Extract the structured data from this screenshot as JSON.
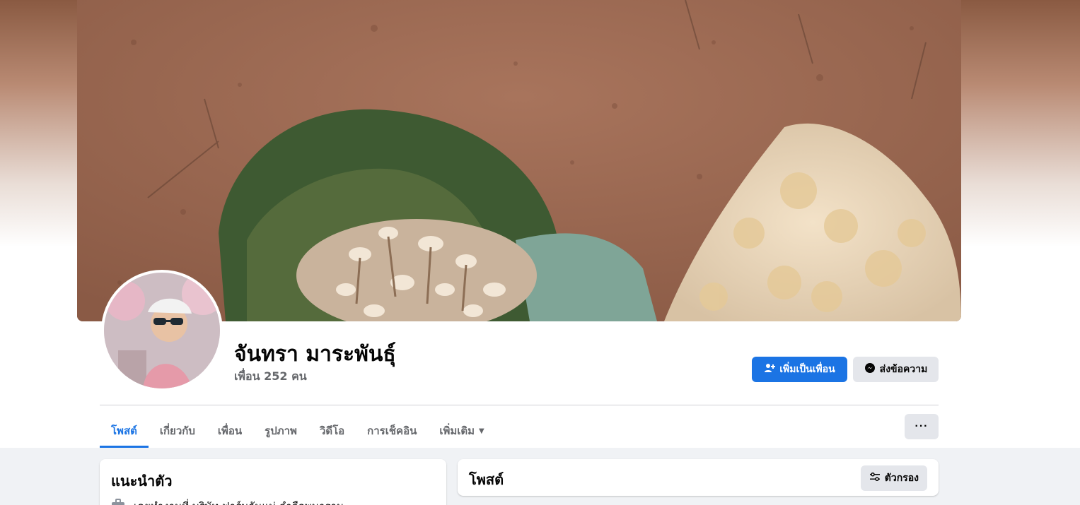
{
  "profile": {
    "name": "จันทรา มาระพันธุ์",
    "friends_count": "เพื่อน 252 คน"
  },
  "actions": {
    "add_friend": "เพิ่มเป็นเพื่อน",
    "message": "ส่งข้อความ",
    "more": "···"
  },
  "tabs": [
    {
      "label": "โพสต์",
      "active": true
    },
    {
      "label": "เกี่ยวกับ"
    },
    {
      "label": "เพื่อน"
    },
    {
      "label": "รูปภาพ"
    },
    {
      "label": "วิดีโอ"
    },
    {
      "label": "การเช็คอิน"
    },
    {
      "label": "เพิ่มเติม"
    }
  ],
  "intro": {
    "title": "แนะนำตัว",
    "work_line": "เคยทำงานที่ บริษัท ฟาร์มกันแน่ ลำลือพนาราม"
  },
  "posts": {
    "title": "โพสต์",
    "filter_label": "ตัวกรอง"
  },
  "colors": {
    "accent": "#1b74e4",
    "secondary_button": "#e4e6eb",
    "muted_text": "#65676b"
  },
  "icons": [
    "add-friend-icon",
    "messenger-icon",
    "chevron-down-icon",
    "filter-icon",
    "briefcase-icon"
  ]
}
